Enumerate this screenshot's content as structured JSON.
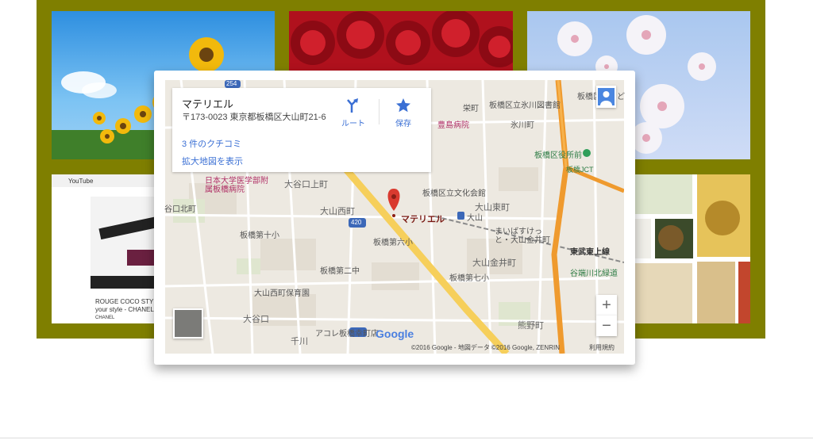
{
  "info_window": {
    "place_name": "マテリエル",
    "address": "〒173-0023 東京都板橋区大山町21-6",
    "reviews_link": "3 件のクチコミ",
    "larger_map_link": "拡大地図を表示",
    "route_label": "ルート",
    "save_label": "保存"
  },
  "map": {
    "marker_label": "マテリエル",
    "zoom_in": "+",
    "zoom_out": "−",
    "google_logo": "Google",
    "attribution": "©2016 Google - 地図データ ©2016 Google, ZENRIN",
    "terms": "利用規約",
    "labels": {
      "sakaecho": "栄町",
      "itabashi_hikawa_library": "板橋区立氷川図書館",
      "hikawacho": "氷川町",
      "toshima_hospital": "豊島病院",
      "itabashi_ward_office": "板橋区役所前",
      "itabashi_jct": "板橋JCT",
      "nihon_univ_hospital": "日本大学医学部附属板橋病院",
      "oyaguchi_kamicho": "大谷口上町",
      "bunka_kaikan": "板橋区立文化会館",
      "oyaguchi_kitacho": "谷口北町",
      "oyama_nishimachi": "大山西町",
      "oyama_station": "大山",
      "oyama_higashicho": "大山東町",
      "itabashi_10": "板橋第十小",
      "itabashi_6": "板橋第六小",
      "mabashisuttsu": "まいばすけっと・大山金井町",
      "tobu_tojo": "東武東上線",
      "oyama_kanaicho": "大山金井町",
      "itabashi_2": "板橋第二中",
      "itabashi_7": "板橋第七小",
      "yahatagawa": "谷端川北緑道",
      "oyama_hoikuen": "大山西町保育園",
      "oyaguchi": "大谷口",
      "senkawa": "千川",
      "acore": "アコレ板橋幸町店",
      "kumanocho": "熊野町",
      "route_420": "420",
      "route_254": "254",
      "kokodo": "板橋区立こど"
    }
  },
  "youtube_tile": {
    "logo": "YouTube",
    "caption_line1": "ROUGE COCO STYL",
    "caption_line2": "your style - CHANEL",
    "channel": "CHANEL"
  },
  "colors": {
    "frame_background": "#7f7f00",
    "link": "#3a6fd4",
    "marker": "#d93a2f"
  }
}
